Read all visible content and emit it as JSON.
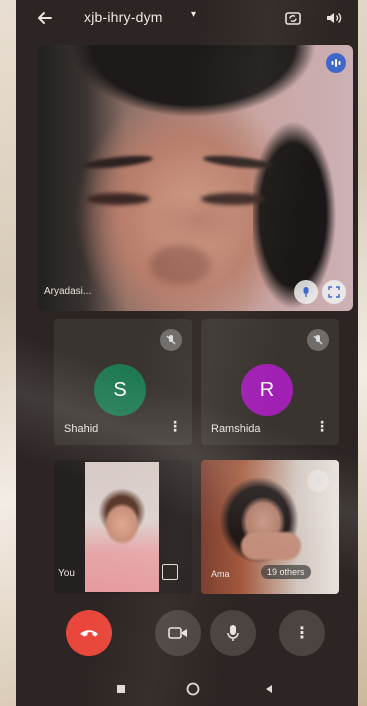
{
  "header": {
    "meeting_code": "xjb-ihry-dym",
    "caret": "▾"
  },
  "main_speaker": {
    "name": "Aryadasi..."
  },
  "participants": [
    {
      "initial": "S",
      "name": "Shahid",
      "avatar_color": "#1f7a53"
    },
    {
      "initial": "R",
      "name": "Ramshida",
      "avatar_color": "#a020b4"
    }
  ],
  "self_tile": {
    "label": "You"
  },
  "group_tile": {
    "name": "Ama",
    "others_label": "19 others"
  },
  "controls": {
    "more_label": "⋮"
  },
  "colors": {
    "end_call": "#e9473c",
    "audio_badge": "#3f67c9"
  }
}
